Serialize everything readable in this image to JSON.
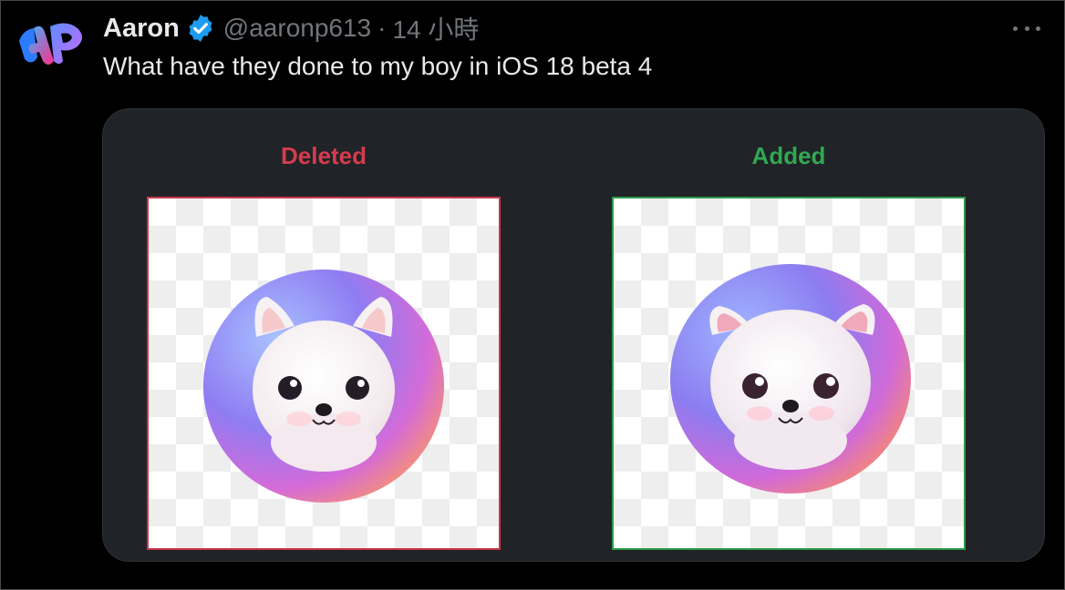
{
  "tweet": {
    "author_name": "Aaron",
    "handle": "@aaronp613",
    "separator": "·",
    "time": "14 小時",
    "text": "What have they done to my boy in iOS 18 beta 4",
    "avatar_icon": "ap-logo-icon",
    "verified_icon": "verified-badge-icon",
    "more_icon": "more-dots-icon"
  },
  "media": {
    "panels": [
      {
        "label": "Deleted",
        "color": "#d63b4e",
        "border": "#c9384a"
      },
      {
        "label": "Added",
        "color": "#32a852",
        "border": "#2f9a4a"
      }
    ],
    "background": "#202327"
  }
}
